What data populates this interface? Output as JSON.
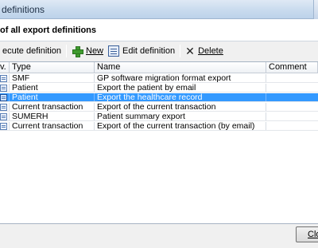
{
  "window": {
    "title": "definitions"
  },
  "header": {
    "heading": "of all export definitions"
  },
  "toolbar": {
    "execute_label": "ecute definition",
    "new_label": "New",
    "edit_label": "Edit definition",
    "delete_label": "Delete"
  },
  "grid": {
    "columns": [
      "v.",
      "Type",
      "Name",
      "Comment"
    ],
    "rows": [
      {
        "type": "SMF",
        "name": "GP software migration format export",
        "comment": ""
      },
      {
        "type": "Patient",
        "name": "Export the patient by email",
        "comment": ""
      },
      {
        "type": "Patient",
        "name": "Export the healthcare record",
        "comment": ""
      },
      {
        "type": "Current transaction",
        "name": "Export of the current transaction",
        "comment": ""
      },
      {
        "type": "SUMERH",
        "name": "Patient summary export",
        "comment": ""
      },
      {
        "type": "Current transaction",
        "name": "Export of the current transaction (by email)",
        "comment": ""
      }
    ],
    "selected_index": 2
  },
  "footer": {
    "close_label": "Clos"
  },
  "colors": {
    "selection": "#3399ff",
    "titlebar": "#c9dbee"
  }
}
